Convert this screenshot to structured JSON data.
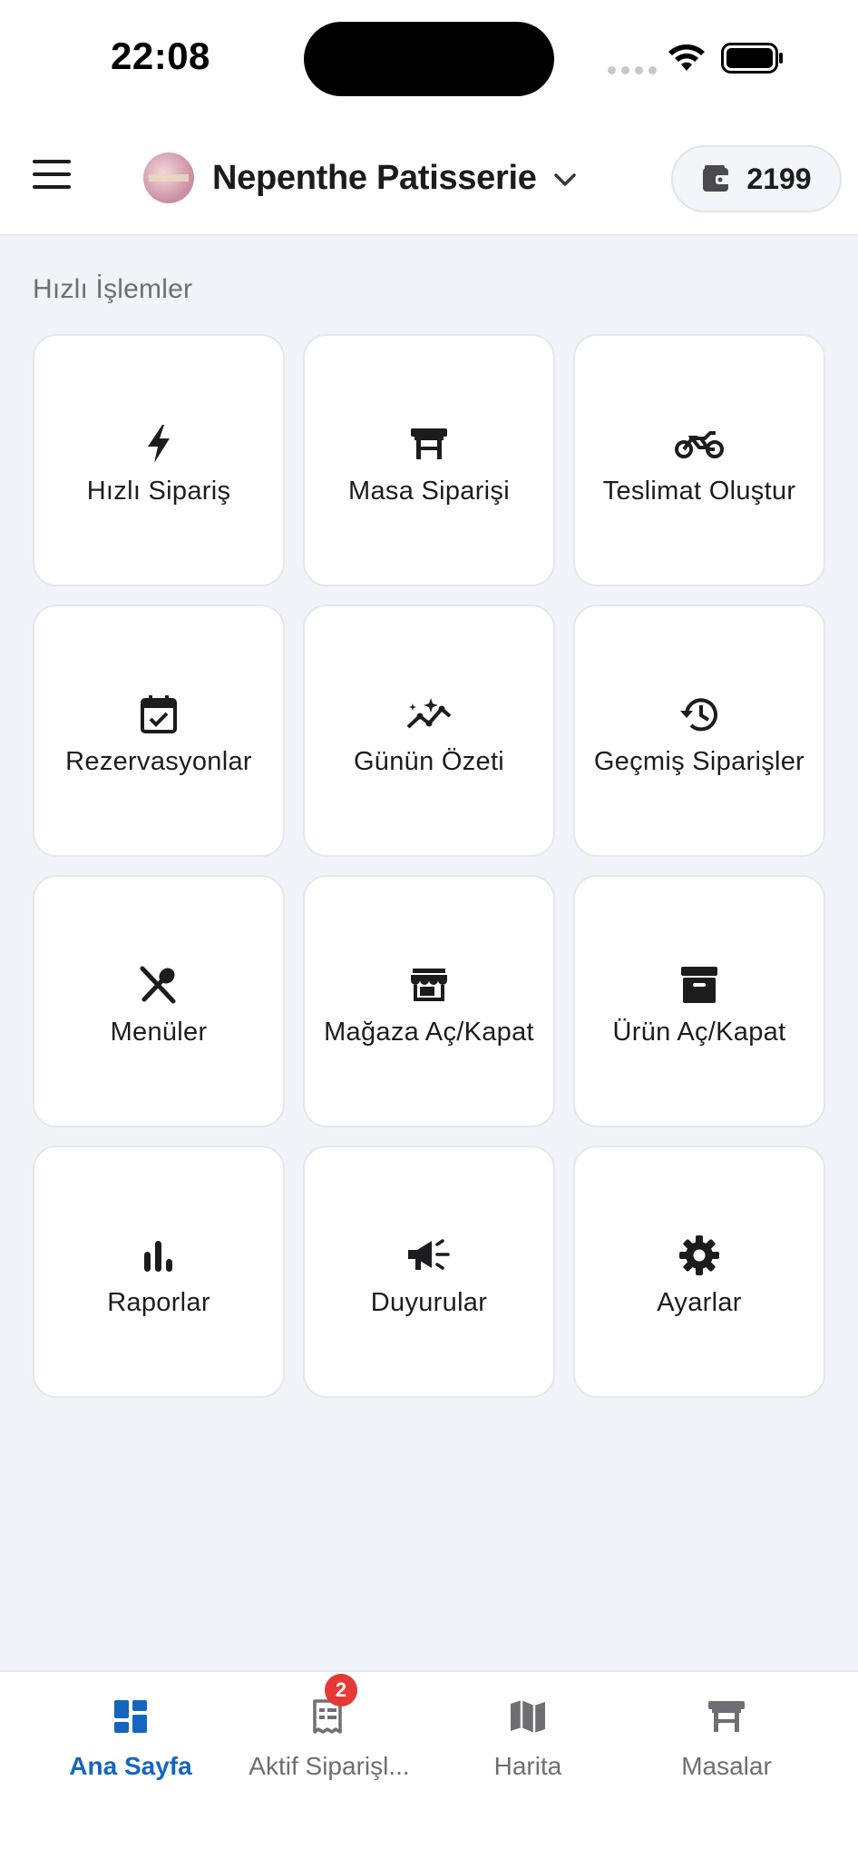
{
  "status_bar": {
    "time": "22:08"
  },
  "header": {
    "store_name": "Nepenthe Patisserie",
    "wallet_value": "2199"
  },
  "quick_actions": {
    "title": "Hızlı İşlemler",
    "items": [
      {
        "label": "Hızlı Sipariş",
        "icon": "bolt-icon"
      },
      {
        "label": "Masa Siparişi",
        "icon": "table-icon"
      },
      {
        "label": "Teslimat Oluştur",
        "icon": "motorcycle-icon"
      },
      {
        "label": "Rezervasyonlar",
        "icon": "calendar-check-icon"
      },
      {
        "label": "Günün Özeti",
        "icon": "sparkle-chart-icon"
      },
      {
        "label": "Geçmiş Siparişler",
        "icon": "history-icon"
      },
      {
        "label": "Menüler",
        "icon": "utensils-icon"
      },
      {
        "label": "Mağaza Aç/Kapat",
        "icon": "store-icon"
      },
      {
        "label": "Ürün Aç/Kapat",
        "icon": "archive-icon"
      },
      {
        "label": "Raporlar",
        "icon": "bar-chart-icon"
      },
      {
        "label": "Duyurular",
        "icon": "megaphone-icon"
      },
      {
        "label": "Ayarlar",
        "icon": "gear-icon"
      }
    ]
  },
  "bottom_nav": {
    "items": [
      {
        "label": "Ana Sayfa",
        "icon": "dashboard-icon",
        "active": true
      },
      {
        "label": "Aktif Siparişl...",
        "icon": "receipt-icon",
        "badge": "2"
      },
      {
        "label": "Harita",
        "icon": "map-icon"
      },
      {
        "label": "Masalar",
        "icon": "table-icon"
      }
    ]
  },
  "colors": {
    "accent": "#1565c0",
    "badge": "#e53935",
    "background": "#f0f3f8"
  }
}
